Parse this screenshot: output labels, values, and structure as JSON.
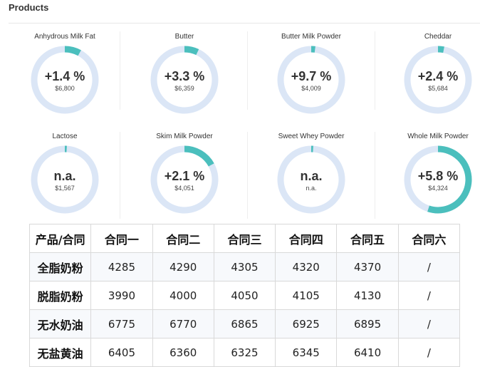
{
  "section": {
    "title": "Products"
  },
  "accent_color": "#4bbfbd",
  "track_color": "#dbe6f6",
  "products": [
    {
      "name": "Anhydrous Milk Fat",
      "change": "+1.4 %",
      "price": "$6,800",
      "fill_fraction": 0.08
    },
    {
      "name": "Butter",
      "change": "+3.3 %",
      "price": "$6,359",
      "fill_fraction": 0.07
    },
    {
      "name": "Butter Milk Powder",
      "change": "+9.7 %",
      "price": "$4,009",
      "fill_fraction": 0.02
    },
    {
      "name": "Cheddar",
      "change": "+2.4 %",
      "price": "$5,684",
      "fill_fraction": 0.03
    },
    {
      "name": "Lactose",
      "change": "n.a.",
      "price": "$1,567",
      "fill_fraction": 0.01
    },
    {
      "name": "Skim Milk Powder",
      "change": "+2.1 %",
      "price": "$4,051",
      "fill_fraction": 0.17
    },
    {
      "name": "Sweet Whey Powder",
      "change": "n.a.",
      "price": "n.a.",
      "fill_fraction": 0.01
    },
    {
      "name": "Whole Milk Powder",
      "change": "+5.8 %",
      "price": "$4,324",
      "fill_fraction": 0.55
    }
  ],
  "contracts_table": {
    "headers": [
      "产品/合同",
      "合同一",
      "合同二",
      "合同三",
      "合同四",
      "合同五",
      "合同六"
    ],
    "rows": [
      [
        "全脂奶粉",
        "4285",
        "4290",
        "4305",
        "4320",
        "4370",
        "/"
      ],
      [
        "脱脂奶粉",
        "3990",
        "4000",
        "4050",
        "4105",
        "4130",
        "/"
      ],
      [
        "无水奶油",
        "6775",
        "6770",
        "6865",
        "6925",
        "6895",
        "/"
      ],
      [
        "无盐黄油",
        "6405",
        "6360",
        "6325",
        "6345",
        "6410",
        "/"
      ]
    ]
  }
}
